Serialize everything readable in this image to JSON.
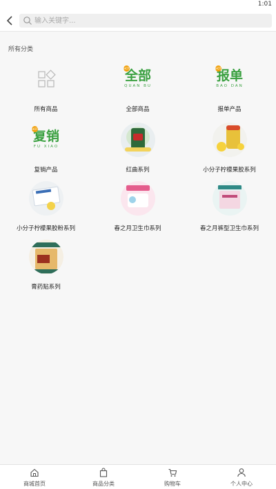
{
  "status_bar": {
    "time": "1:01"
  },
  "header": {
    "back_icon": "chevron-left-icon",
    "search": {
      "icon": "search-icon",
      "placeholder": "输入关键字..."
    }
  },
  "section_title": "所有分类",
  "categories": [
    {
      "label": "所有商品",
      "thumb": "grid-squares-icon"
    },
    {
      "label": "全部商品",
      "thumb": "wordmark",
      "wordmark_cn": "全部",
      "wordmark_py": "QUAN BU",
      "badge": "hot"
    },
    {
      "label": "报单产品",
      "thumb": "wordmark",
      "wordmark_cn": "报单",
      "wordmark_py": "BAO DAN",
      "badge": "hot"
    },
    {
      "label": "复销产品",
      "thumb": "wordmark",
      "wordmark_cn": "复销",
      "wordmark_py": "FU XIAO",
      "badge": "hot"
    },
    {
      "label": "红曲系列",
      "thumb": "product-photo"
    },
    {
      "label": "小分子柠檬果胶系列",
      "thumb": "product-photo"
    },
    {
      "label": "小分子柠檬果胶粉系列",
      "thumb": "product-photo"
    },
    {
      "label": "春之月卫生巾系列",
      "thumb": "product-photo"
    },
    {
      "label": "春之月裤型卫生巾系列",
      "thumb": "product-photo"
    },
    {
      "label": "膏药贴系列",
      "thumb": "product-photo"
    }
  ],
  "tabbar": [
    {
      "label": "商城首页",
      "icon": "home-icon"
    },
    {
      "label": "商品分类",
      "icon": "shopping-bag-icon"
    },
    {
      "label": "购物车",
      "icon": "cart-icon"
    },
    {
      "label": "个人中心",
      "icon": "user-icon"
    }
  ],
  "colors": {
    "brand_green": "#3aa040",
    "badge_orange": "#f1a10c"
  }
}
